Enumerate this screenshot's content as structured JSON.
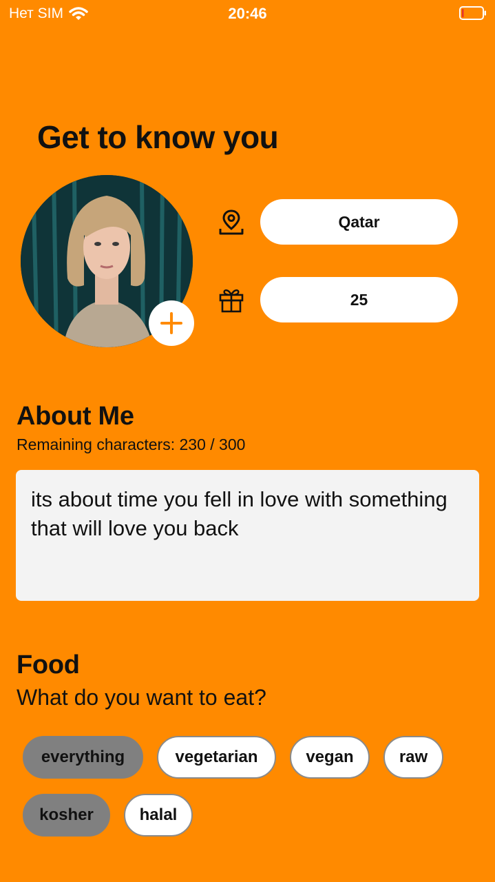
{
  "status_bar": {
    "carrier": "Нет SIM",
    "time": "20:46"
  },
  "page": {
    "title": "Get to know you"
  },
  "profile": {
    "location": "Qatar",
    "age": "25"
  },
  "about": {
    "title": "About Me",
    "remaining": "Remaining characters: 230 / 300",
    "text": "its about time you fell in love with something that will love you back"
  },
  "food": {
    "title": "Food",
    "subtitle": "What do you want to eat?",
    "options": [
      {
        "label": "everything",
        "selected": true
      },
      {
        "label": "vegetarian",
        "selected": false
      },
      {
        "label": "vegan",
        "selected": false
      },
      {
        "label": "raw",
        "selected": false
      },
      {
        "label": "kosher",
        "selected": true
      },
      {
        "label": "halal",
        "selected": false
      }
    ]
  },
  "colors": {
    "background": "#FF8A00",
    "selected_chip": "#808080",
    "field": "#FFFFFF",
    "text_area": "#F3F3F3",
    "accent": "#FF8A00"
  }
}
